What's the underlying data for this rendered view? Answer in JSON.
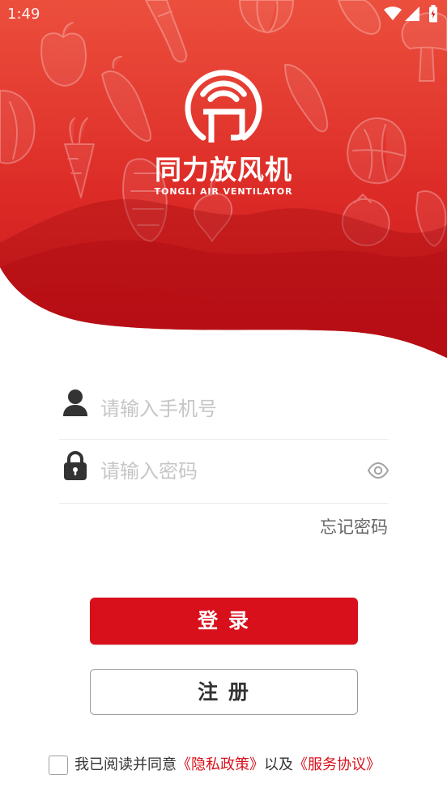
{
  "status_bar": {
    "time": "1:49",
    "icons": [
      "wifi-icon",
      "signal-icon",
      "battery-icon"
    ]
  },
  "brand": {
    "logo_icon": "tongli-logo-icon",
    "name": "同力放风机",
    "subtitle": "TONGLI AIR VENTILATOR"
  },
  "login_form": {
    "phone": {
      "icon": "user-icon",
      "placeholder": "请输入手机号",
      "value": ""
    },
    "password": {
      "icon": "lock-icon",
      "placeholder": "请输入密码",
      "value": "",
      "toggle_icon": "eye-icon"
    },
    "forgot_password": "忘记密码",
    "login_label": "登 录",
    "register_label": "注 册"
  },
  "agreement": {
    "checked": false,
    "prefix": "我已阅读并同意",
    "privacy_link": "《隐私政策》",
    "conjunction": "以及",
    "terms_link": "《服务协议》"
  },
  "colors": {
    "brand_red": "#d8101b",
    "header_top": "#ea4a3a",
    "header_bottom": "#c7141d",
    "placeholder": "#c6c6c6",
    "text": "#333333",
    "muted": "#666666"
  }
}
